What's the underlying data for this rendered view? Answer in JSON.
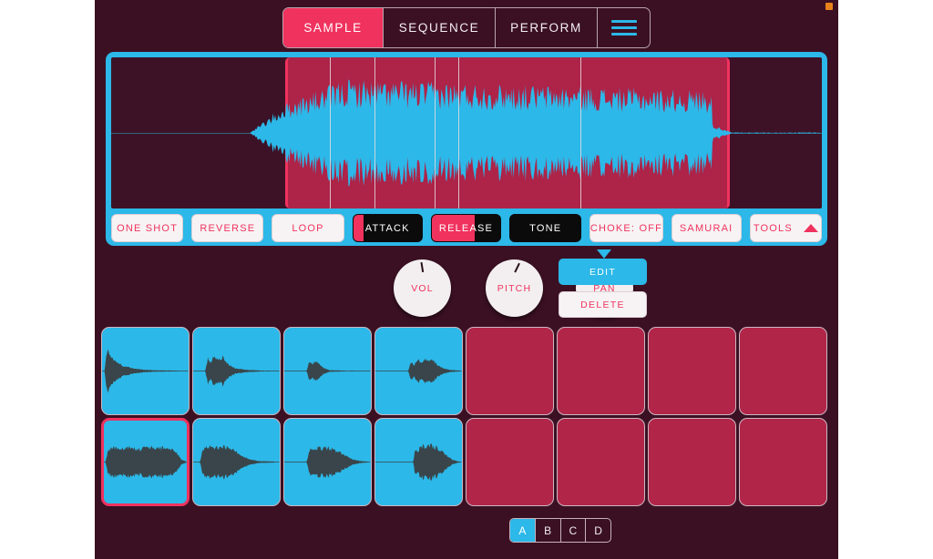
{
  "app": {
    "background": "#3b1023",
    "accent_cyan": "#2cb8e8",
    "accent_pink": "#f0325e",
    "pad_empty": "#b12549"
  },
  "status_indicator": {
    "name": "record-status-dot",
    "color": "#e8821a"
  },
  "tabs": [
    {
      "label": "SAMPLE",
      "active": true
    },
    {
      "label": "SEQUENCE",
      "active": false
    },
    {
      "label": "PERFORM",
      "active": false
    },
    {
      "label": "",
      "active": false,
      "icon": "hamburger-menu-icon"
    }
  ],
  "waveform": {
    "selection_start_pct": 24.5,
    "selection_end_pct": 87.0,
    "slice_markers_pct": [
      30.8,
      37.0,
      45.5,
      48.8,
      66.0
    ],
    "waveform_color": "#2cb8e8",
    "selection_color": "#ae2348",
    "background_color": "#3d1226"
  },
  "mode_buttons": [
    {
      "label": "ONE SHOT",
      "style": "light",
      "key": "one-shot"
    },
    {
      "label": "REVERSE",
      "style": "light",
      "key": "reverse"
    },
    {
      "label": "LOOP",
      "style": "light",
      "key": "loop"
    },
    {
      "label": "ATTACK",
      "style": "dark-bar",
      "key": "attack"
    },
    {
      "label": "RELEASE",
      "style": "half-pink",
      "key": "release"
    },
    {
      "label": "TONE",
      "style": "dark",
      "key": "tone"
    },
    {
      "label": "CHOKE: OFF",
      "style": "light",
      "key": "choke"
    },
    {
      "label": "SAMURAI",
      "style": "light",
      "key": "samurai"
    },
    {
      "label": "TOOLS",
      "style": "light-tri",
      "key": "tools"
    }
  ],
  "knobs": [
    {
      "label": "VOL",
      "angle_deg": -9
    },
    {
      "label": "PITCH",
      "angle_deg": 26
    },
    {
      "label": "PAN",
      "angle_deg": 0
    }
  ],
  "actions": {
    "edit_label": "EDIT",
    "delete_label": "DELETE"
  },
  "pads": {
    "rows": [
      [
        {
          "loaded": true,
          "selected": false,
          "wave": "decay-sharp"
        },
        {
          "loaded": true,
          "selected": false,
          "wave": "decay-short"
        },
        {
          "loaded": true,
          "selected": false,
          "wave": "blip"
        },
        {
          "loaded": true,
          "selected": false,
          "wave": "double-hit"
        },
        {
          "loaded": false,
          "selected": false,
          "wave": ""
        },
        {
          "loaded": false,
          "selected": false,
          "wave": ""
        },
        {
          "loaded": false,
          "selected": false,
          "wave": ""
        },
        {
          "loaded": false,
          "selected": false,
          "wave": ""
        }
      ],
      [
        {
          "loaded": true,
          "selected": true,
          "wave": "sustain-long"
        },
        {
          "loaded": true,
          "selected": false,
          "wave": "sustain-mid"
        },
        {
          "loaded": true,
          "selected": false,
          "wave": "sustain-taper"
        },
        {
          "loaded": true,
          "selected": false,
          "wave": "sustain-swell"
        },
        {
          "loaded": false,
          "selected": false,
          "wave": ""
        },
        {
          "loaded": false,
          "selected": false,
          "wave": ""
        },
        {
          "loaded": false,
          "selected": false,
          "wave": ""
        },
        {
          "loaded": false,
          "selected": false,
          "wave": ""
        }
      ]
    ]
  },
  "banks": [
    {
      "label": "A",
      "active": true
    },
    {
      "label": "B",
      "active": false
    },
    {
      "label": "C",
      "active": false
    },
    {
      "label": "D",
      "active": false
    }
  ]
}
